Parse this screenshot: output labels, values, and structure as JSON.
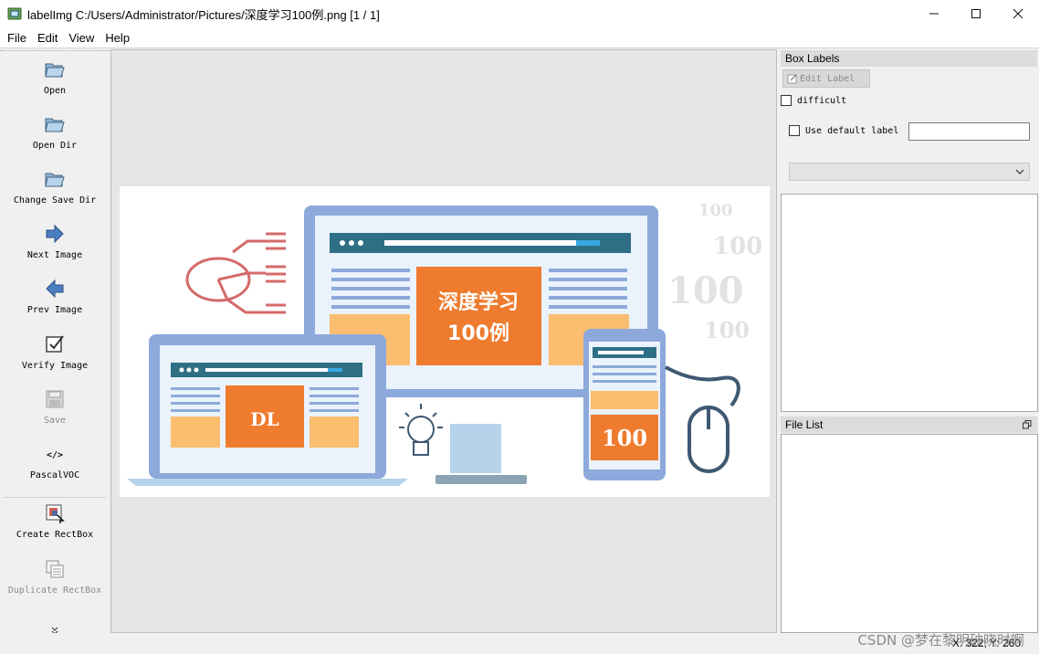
{
  "window": {
    "title": "labelImg C:/Users/Administrator/Pictures/深度学习100例.png [1 / 1]",
    "controls": [
      "minimize",
      "maximize",
      "close"
    ]
  },
  "menu": [
    "File",
    "Edit",
    "View",
    "Help"
  ],
  "toolbar": {
    "items": [
      {
        "label": "Open",
        "icon": "folder-icon",
        "enabled": true
      },
      {
        "label": "Open Dir",
        "icon": "folder-icon",
        "enabled": true
      },
      {
        "label": "Change Save Dir",
        "icon": "folder-icon",
        "enabled": true
      },
      {
        "label": "Next Image",
        "icon": "arrow-right-icon",
        "enabled": true
      },
      {
        "label": "Prev Image",
        "icon": "arrow-left-icon",
        "enabled": true
      },
      {
        "label": "Verify Image",
        "icon": "checkbox-icon",
        "enabled": true
      },
      {
        "label": "Save",
        "icon": "save-icon",
        "enabled": false
      },
      {
        "label": "PascalVOC",
        "icon": "code-icon",
        "enabled": true
      },
      {
        "label": "Create RectBox",
        "icon": "rectbox-icon",
        "enabled": true
      },
      {
        "label": "Duplicate RectBox",
        "icon": "duplicate-icon",
        "enabled": false
      }
    ],
    "more_icon": "double-chevron-down-icon"
  },
  "image": {
    "main_title_line1": "深度学习",
    "main_title_line2": "100例",
    "laptop_text": "DL",
    "phone_text": "100",
    "deco_numbers": [
      "100",
      "100",
      "100",
      "100"
    ]
  },
  "box_labels": {
    "title": "Box Labels",
    "edit_label_button": "Edit Label",
    "difficult_label": "difficult",
    "use_default_label": "Use default label",
    "default_label_value": ""
  },
  "file_list": {
    "title": "File List"
  },
  "status": {
    "coords": "X: 322; Y: 260"
  },
  "watermark": "CSDN @梦在黎明破晓时啊"
}
